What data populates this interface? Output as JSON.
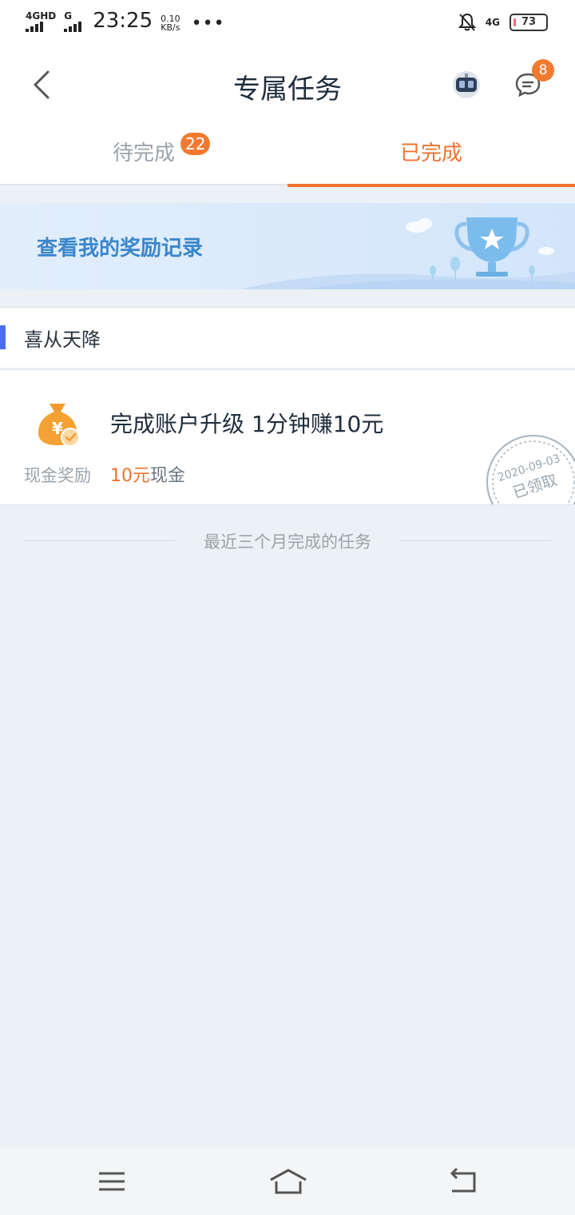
{
  "status_bar": {
    "network1": "4GHD",
    "network2": "G",
    "time": "23:25",
    "speed_value": "0.10",
    "speed_unit": "KB/s",
    "dots": "•••",
    "network3": "4G",
    "battery": "73"
  },
  "header": {
    "title": "专属任务",
    "message_badge": "8"
  },
  "tabs": {
    "pending_label": "待完成",
    "pending_count": "22",
    "done_label": "已完成"
  },
  "banner": {
    "text": "查看我的奖励记录"
  },
  "section": {
    "title": "喜从天降"
  },
  "task": {
    "title": "完成账户升级 1分钟赚10元",
    "reward_label": "现金奖励",
    "reward_amount": "10元",
    "reward_suffix": "现金",
    "stamp_date": "2020-09-03",
    "stamp_text": "已领取"
  },
  "footer_note": "最近三个月完成的任务",
  "colors": {
    "accent": "#f07230",
    "banner_text": "#3a86cc",
    "section_mark": "#4c6ef5"
  }
}
